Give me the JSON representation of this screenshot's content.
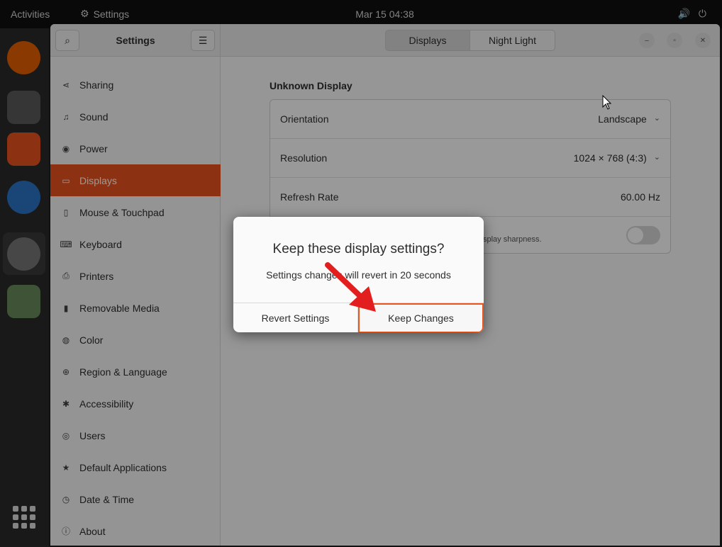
{
  "topbar": {
    "activities": "Activities",
    "app_name": "Settings",
    "clock": "Mar 15  04:38"
  },
  "window": {
    "sidebar_title": "Settings",
    "tabs": [
      {
        "label": "Displays",
        "active": true
      },
      {
        "label": "Night Light",
        "active": false
      }
    ]
  },
  "sidebar": {
    "items": [
      {
        "label": "Sharing",
        "icon": "share-icon"
      },
      {
        "label": "Sound",
        "icon": "music-note-icon"
      },
      {
        "label": "Power",
        "icon": "power-icon"
      },
      {
        "label": "Displays",
        "icon": "display-icon",
        "active": true
      },
      {
        "label": "Mouse & Touchpad",
        "icon": "mouse-icon"
      },
      {
        "label": "Keyboard",
        "icon": "keyboard-icon"
      },
      {
        "label": "Printers",
        "icon": "printer-icon"
      },
      {
        "label": "Removable Media",
        "icon": "usb-drive-icon"
      },
      {
        "label": "Color",
        "icon": "color-icon"
      },
      {
        "label": "Region & Language",
        "icon": "globe-icon"
      },
      {
        "label": "Accessibility",
        "icon": "accessibility-icon"
      },
      {
        "label": "Users",
        "icon": "users-icon"
      },
      {
        "label": "Default Applications",
        "icon": "star-icon"
      },
      {
        "label": "Date & Time",
        "icon": "clock-icon"
      },
      {
        "label": "About",
        "icon": "info-icon"
      }
    ]
  },
  "display": {
    "name": "Unknown Display",
    "orientation_label": "Orientation",
    "orientation_value": "Landscape",
    "resolution_label": "Resolution",
    "resolution_value": "1024 × 768 (4:3)",
    "refresh_label": "Refresh Rate",
    "refresh_value": "60.00 Hz",
    "sharpness_text": "splay sharpness."
  },
  "dialog": {
    "title": "Keep these display settings?",
    "subtitle": "Settings changes will revert in 20 seconds",
    "revert_label": "Revert Settings",
    "keep_label": "Keep Changes"
  },
  "colors": {
    "accent": "#e9541f",
    "arrow": "#e31e1e"
  }
}
